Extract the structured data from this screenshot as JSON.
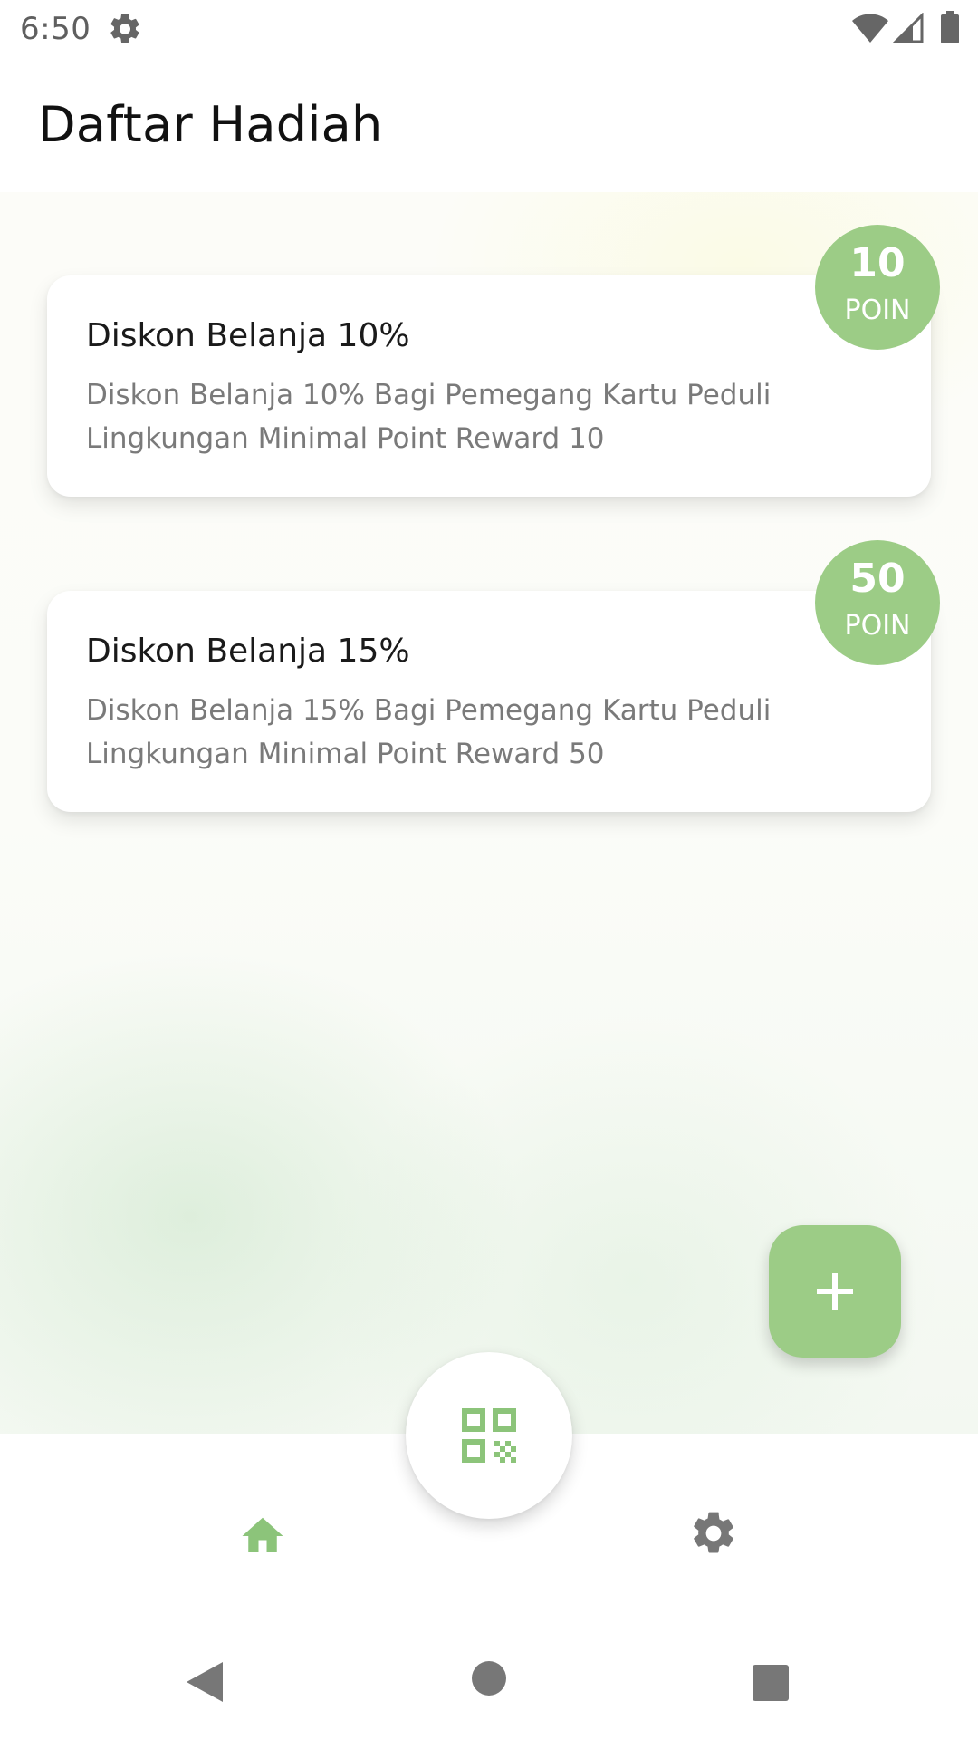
{
  "status_bar": {
    "time": "6:50",
    "icons": [
      "gear-icon",
      "wifi-icon",
      "signal-icon",
      "battery-icon"
    ]
  },
  "app_bar": {
    "title": "Daftar Hadiah"
  },
  "rewards": [
    {
      "title": "Diskon Belanja 10%",
      "description": "Diskon Belanja 10% Bagi Pemegang Kartu Peduli Lingkungan Minimal Point Reward 10",
      "points": "10",
      "points_unit": "POIN"
    },
    {
      "title": "Diskon Belanja 15%",
      "description": "Diskon Belanja 15% Bagi Pemegang Kartu Peduli Lingkungan Minimal Point Reward 50",
      "points": "50",
      "points_unit": "POIN"
    }
  ],
  "fab": {
    "icon": "plus-icon"
  },
  "bottom_nav": {
    "items": [
      "home-icon",
      "qr-code-icon",
      "settings-icon"
    ]
  },
  "system_nav": {
    "items": [
      "back-icon",
      "home-circle-icon",
      "recents-icon"
    ]
  },
  "colors": {
    "accent": "#9ccc86",
    "text_primary": "#1a1a1a",
    "text_secondary": "#7a7a7a",
    "icon_grey": "#777777"
  }
}
